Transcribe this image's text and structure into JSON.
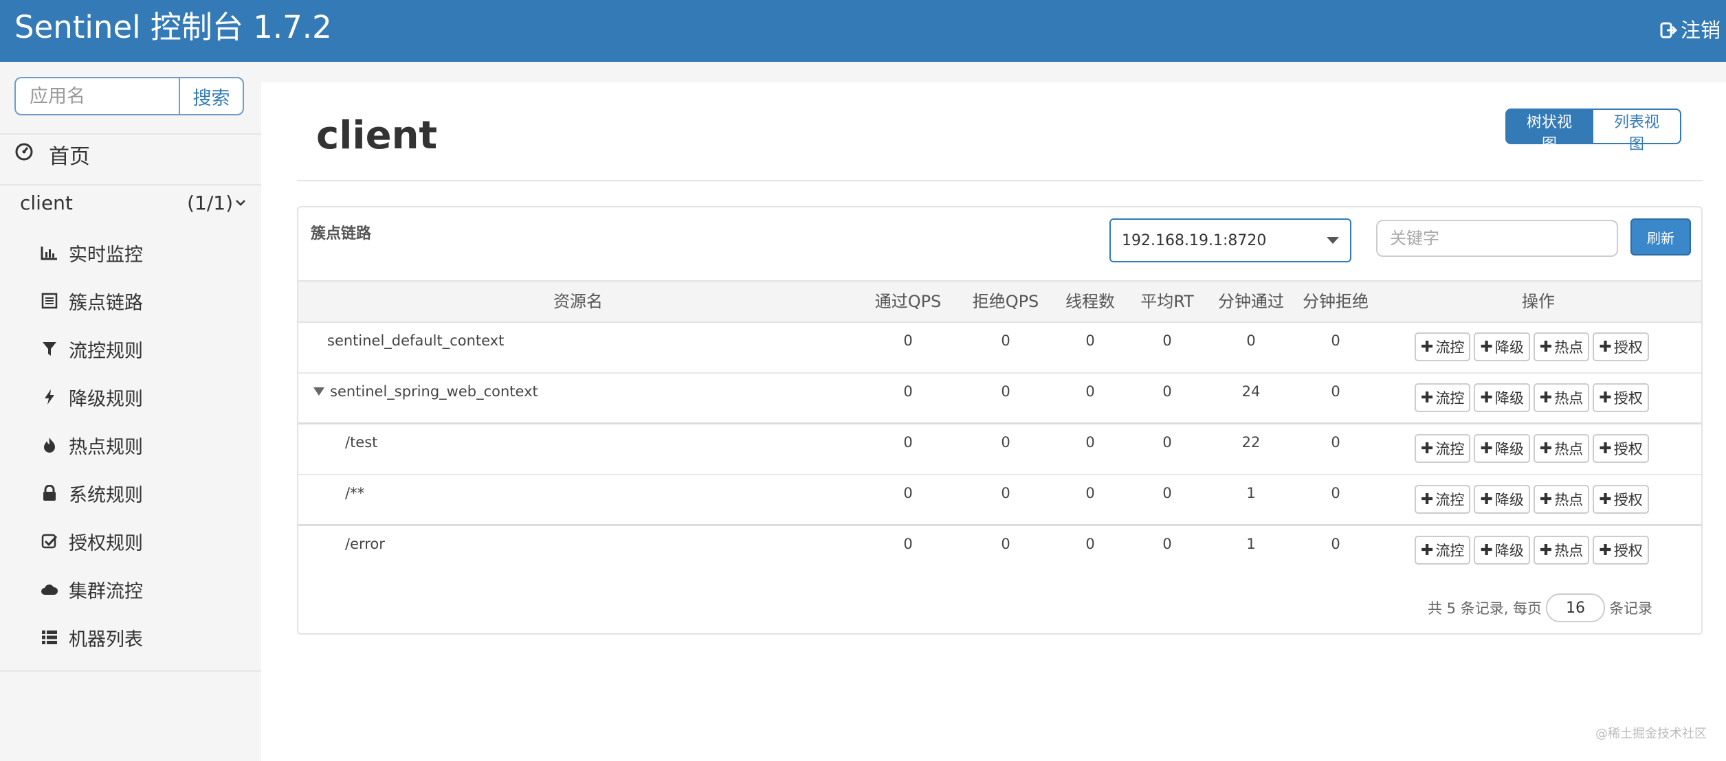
{
  "header": {
    "title": "Sentinel 控制台 1.7.2",
    "logout_label": "注销",
    "logout_icon": "sign-out-icon"
  },
  "sidebar": {
    "search": {
      "placeholder": "应用名",
      "button_label": "搜索"
    },
    "home_label": "首页",
    "app": {
      "name": "client",
      "count": "(1/1)"
    },
    "items": [
      {
        "label": "实时监控",
        "icon": "bar-chart-icon"
      },
      {
        "label": "簇点链路",
        "icon": "list-alt-icon"
      },
      {
        "label": "流控规则",
        "icon": "filter-icon"
      },
      {
        "label": "降级规则",
        "icon": "flash-icon"
      },
      {
        "label": "热点规则",
        "icon": "fire-icon"
      },
      {
        "label": "系统规则",
        "icon": "lock-icon"
      },
      {
        "label": "授权规则",
        "icon": "check-icon"
      },
      {
        "label": "集群流控",
        "icon": "cloud-icon"
      },
      {
        "label": "机器列表",
        "icon": "th-list-icon"
      }
    ]
  },
  "main": {
    "title": "client",
    "view_tree": "树状视图",
    "view_list": "列表视图",
    "card_title": "簇点链路",
    "machine": "192.168.19.1:8720",
    "keyword_placeholder": "关键字",
    "refresh_label": "刷新",
    "columns": [
      "资源名",
      "通过QPS",
      "拒绝QPS",
      "线程数",
      "平均RT",
      "分钟通过",
      "分钟拒绝",
      "操作"
    ],
    "rows": [
      {
        "name": "sentinel_default_context",
        "pass_qps": "0",
        "block_qps": "0",
        "threads": "0",
        "avg_rt": "0",
        "min_pass": "0",
        "min_block": "0"
      },
      {
        "name": "sentinel_spring_web_context",
        "pass_qps": "0",
        "block_qps": "0",
        "threads": "0",
        "avg_rt": "0",
        "min_pass": "24",
        "min_block": "0"
      },
      {
        "name": "/test",
        "pass_qps": "0",
        "block_qps": "0",
        "threads": "0",
        "avg_rt": "0",
        "min_pass": "22",
        "min_block": "0"
      },
      {
        "name": "/**",
        "pass_qps": "0",
        "block_qps": "0",
        "threads": "0",
        "avg_rt": "0",
        "min_pass": "1",
        "min_block": "0"
      },
      {
        "name": "/error",
        "pass_qps": "0",
        "block_qps": "0",
        "threads": "0",
        "avg_rt": "0",
        "min_pass": "1",
        "min_block": "0"
      }
    ],
    "ops": {
      "flow": "流控",
      "degrade": "降级",
      "hotspot": "热点",
      "auth": "授权"
    },
    "pager": {
      "prefix": "共 5 条记录, 每页",
      "page_size": "16",
      "suffix": "条记录"
    }
  },
  "watermark": "@稀土掘金技术社区",
  "colors": {
    "primary": "#337ab7",
    "sidebar_bg": "#f5f5f5"
  }
}
